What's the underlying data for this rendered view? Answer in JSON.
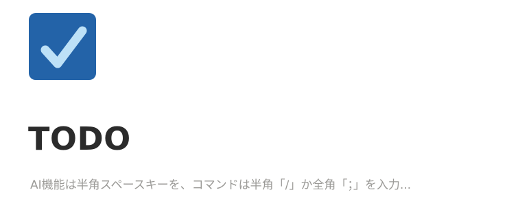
{
  "page": {
    "icon": "checkbox-check-icon",
    "title": "TODO",
    "placeholder": "AI機能は半角スペースキーを、コマンドは半角「/」か全角「；」を入力..."
  },
  "colors": {
    "icon_background": "#2363a8",
    "icon_check": "#bde1f7",
    "title": "#2b2b2b",
    "placeholder": "#9b9a97"
  }
}
